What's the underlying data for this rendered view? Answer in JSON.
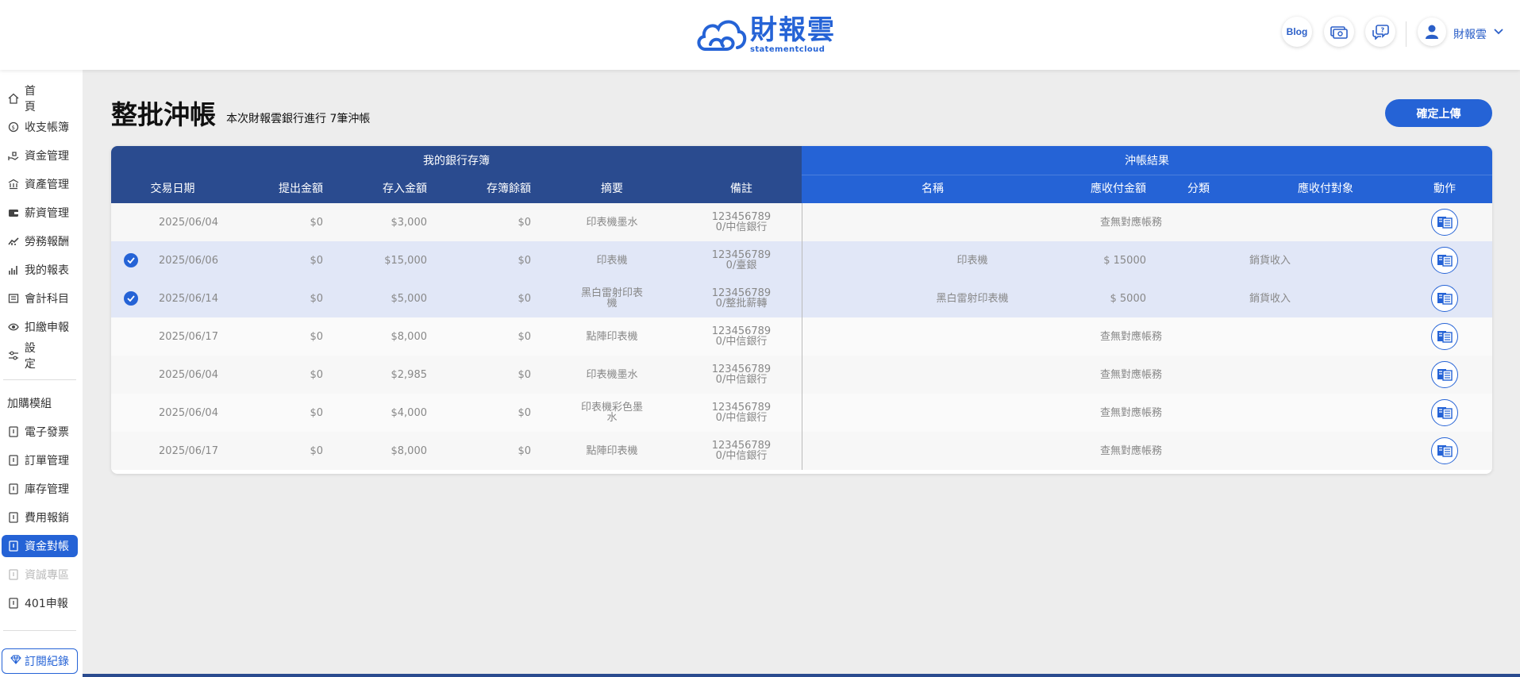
{
  "header": {
    "logo_cn": "財報雲",
    "logo_en": "statementcloud",
    "blog_label": "Blog",
    "user_name": "財報雲"
  },
  "sidebar": {
    "items": [
      {
        "label": "首頁",
        "icon": "home-icon"
      },
      {
        "label": "收支帳簿",
        "icon": "coin-icon"
      },
      {
        "label": "資金管理",
        "icon": "hand-money-icon"
      },
      {
        "label": "資產管理",
        "icon": "bank-icon"
      },
      {
        "label": "薪資管理",
        "icon": "wallet-icon"
      },
      {
        "label": "勞務報酬",
        "icon": "handshake-icon"
      },
      {
        "label": "我的報表",
        "icon": "bar-chart-icon"
      },
      {
        "label": "會計科目",
        "icon": "ledger-icon"
      },
      {
        "label": "扣繳申報",
        "icon": "eye-icon"
      },
      {
        "label": "設定",
        "icon": "sliders-icon"
      }
    ],
    "addon_title": "加購模組",
    "addons": [
      {
        "label": "電子發票",
        "state": "normal"
      },
      {
        "label": "訂單管理",
        "state": "normal"
      },
      {
        "label": "庫存管理",
        "state": "normal"
      },
      {
        "label": "費用報銷",
        "state": "normal"
      },
      {
        "label": "資金對帳",
        "state": "active"
      },
      {
        "label": "資誠專區",
        "state": "disabled"
      },
      {
        "label": "401申報",
        "state": "normal"
      }
    ],
    "subscription_label": "訂閱紀錄"
  },
  "main": {
    "title": "整批沖帳",
    "subtitle": "本次財報雲銀行進行 7筆沖帳",
    "confirm_label": "確定上傳"
  },
  "table": {
    "group_left": "我的銀行存簿",
    "group_right": "沖帳結果",
    "columns": [
      "交易日期",
      "提出金額",
      "存入金額",
      "存簿餘額",
      "摘要",
      "備註",
      "名稱",
      "應收付金額",
      "分類",
      "應收付對象",
      "動作"
    ],
    "rows": [
      {
        "checked": false,
        "date": "2025/06/04",
        "withdraw": "$0",
        "deposit": "$3,000",
        "balance": "$0",
        "summary1": "印表機墨水",
        "summary2": "",
        "note1": "123456789",
        "note2": "0/中信銀行",
        "name": "",
        "amount": "",
        "category": "",
        "party": "",
        "nomatch": "查無對應帳務"
      },
      {
        "checked": true,
        "date": "2025/06/06",
        "withdraw": "$0",
        "deposit": "$15,000",
        "balance": "$0",
        "summary1": "印表機",
        "summary2": "",
        "note1": "123456789",
        "note2": "0/臺銀",
        "name": "印表機",
        "amount": "$ 15000",
        "category": "銷貨收入",
        "party": "",
        "nomatch": ""
      },
      {
        "checked": true,
        "date": "2025/06/14",
        "withdraw": "$0",
        "deposit": "$5,000",
        "balance": "$0",
        "summary1": "黑白雷射印表",
        "summary2": "機",
        "note1": "123456789",
        "note2": "0/整批薪轉",
        "name": "黑白雷射印表機",
        "amount": "$ 5000",
        "category": "銷貨收入",
        "party": "",
        "nomatch": ""
      },
      {
        "checked": false,
        "date": "2025/06/17",
        "withdraw": "$0",
        "deposit": "$8,000",
        "balance": "$0",
        "summary1": "點陣印表機",
        "summary2": "",
        "note1": "123456789",
        "note2": "0/中信銀行",
        "name": "",
        "amount": "",
        "category": "",
        "party": "",
        "nomatch": "查無對應帳務"
      },
      {
        "checked": false,
        "date": "2025/06/04",
        "withdraw": "$0",
        "deposit": "$2,985",
        "balance": "$0",
        "summary1": "印表機墨水",
        "summary2": "",
        "note1": "123456789",
        "note2": "0/中信銀行",
        "name": "",
        "amount": "",
        "category": "",
        "party": "",
        "nomatch": "查無對應帳務"
      },
      {
        "checked": false,
        "date": "2025/06/04",
        "withdraw": "$0",
        "deposit": "$4,000",
        "balance": "$0",
        "summary1": "印表機彩色墨",
        "summary2": "水",
        "note1": "123456789",
        "note2": "0/中信銀行",
        "name": "",
        "amount": "",
        "category": "",
        "party": "",
        "nomatch": "查無對應帳務"
      },
      {
        "checked": false,
        "date": "2025/06/17",
        "withdraw": "$0",
        "deposit": "$8,000",
        "balance": "$0",
        "summary1": "點陣印表機",
        "summary2": "",
        "note1": "123456789",
        "note2": "0/中信銀行",
        "name": "",
        "amount": "",
        "category": "",
        "party": "",
        "nomatch": "查無對應帳務"
      }
    ]
  },
  "colors": {
    "primary": "#2563d6",
    "header_dark": "#2a4b8f",
    "selected_row": "#e1e7f7"
  }
}
